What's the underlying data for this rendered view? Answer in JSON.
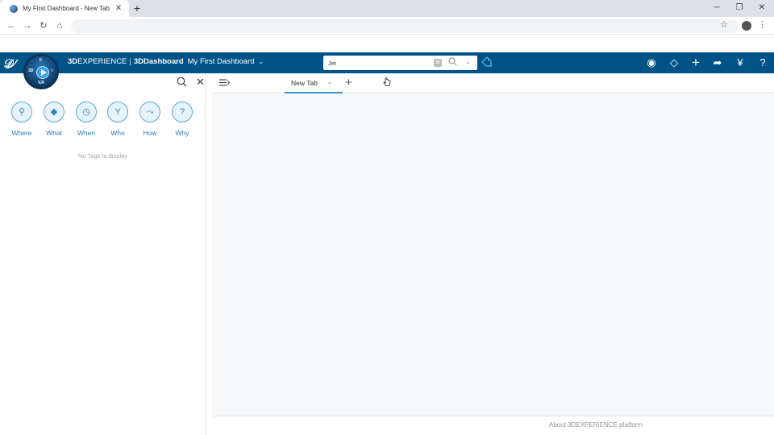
{
  "browser": {
    "tab_title": "My First Dashboard - New Tab",
    "tab_close": "✕",
    "new_tab": "+",
    "window_controls": [
      "─",
      "❐",
      "✕"
    ],
    "nav": {
      "back": "←",
      "forward": "→",
      "reload": "↻",
      "home": "⌂"
    },
    "star": "☆",
    "menu": "⋮"
  },
  "appbar": {
    "brand_3d": "3D",
    "brand_experience": "EXPERIENCE",
    "brand_sep": "|",
    "brand_app": "3DDashboard",
    "dashboard_name": "My First Dashboard",
    "dashboard_chevron": "⌄",
    "compass_labels": {
      "top": "I/",
      "left": "3D",
      "right": "i",
      "bottom": "V,R"
    },
    "search": {
      "value": "Jet",
      "clear": "✕",
      "icon": "search-icon",
      "dropdown": "⌄"
    },
    "icons": [
      "user-icon",
      "tag-icon",
      "add-icon",
      "share-icon",
      "community-icon",
      "help-icon"
    ],
    "icon_glyphs": [
      "◉",
      "◇",
      "+",
      "➦",
      "¥",
      "?"
    ]
  },
  "left_panel": {
    "six_w": [
      {
        "label": "Where",
        "glyph": "⚲"
      },
      {
        "label": "What",
        "glyph": "◆"
      },
      {
        "label": "When",
        "glyph": "◷"
      },
      {
        "label": "Who",
        "glyph": "Y"
      },
      {
        "label": "How",
        "glyph": "⤳"
      },
      {
        "label": "Why",
        "glyph": "?"
      }
    ],
    "empty_text": "No Tags to display",
    "search_glyph": "⌕",
    "close_glyph": "✕"
  },
  "main": {
    "collapse_glyph": "≡",
    "tabs": [
      {
        "label": "New Tab",
        "chevron": "⌄"
      }
    ],
    "add_tab": "+",
    "footer_link": "About 3DEXPERIENCE platform"
  },
  "colors": {
    "appbar": "#005386",
    "accent": "#3a8fcf",
    "six_w": "#2f7fba"
  }
}
